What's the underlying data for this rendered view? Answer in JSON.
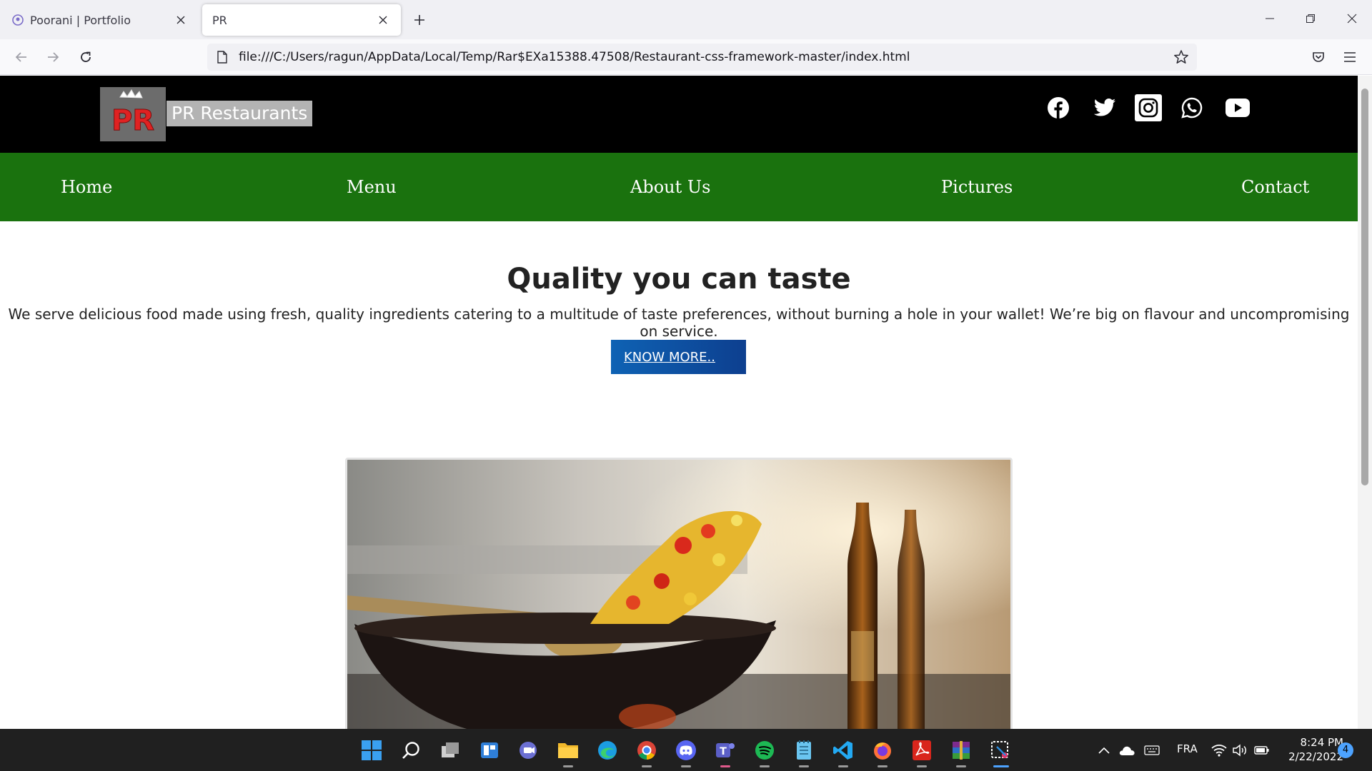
{
  "browser": {
    "tabs": [
      {
        "title": "Poorani | Portfolio",
        "active": false
      },
      {
        "title": "PR",
        "active": true
      }
    ],
    "url": "file:///C:/Users/ragun/AppData/Local/Temp/Rar$EXa15388.47508/Restaurant-css-framework-master/index.html"
  },
  "site": {
    "brand": "PR Restaurants",
    "logo_text": "PR",
    "social": [
      "facebook-icon",
      "twitter-icon",
      "instagram-icon",
      "whatsapp-icon",
      "youtube-icon"
    ],
    "nav": [
      "Home",
      "Menu",
      "About Us",
      "Pictures",
      "Contact"
    ],
    "hero": {
      "title": "Quality you can taste",
      "text": "We serve delicious food made using fresh, quality ingredients catering to a multitude of taste preferences, without burning a hole in your wallet! We’re big on flavour and uncompromising on service.",
      "button": "KNOW MORE.."
    },
    "colors": {
      "header": "#000000",
      "menu": "#1a720e",
      "button": "#0e62b4"
    }
  },
  "taskbar": {
    "language": "FRA",
    "time": "8:24 PM",
    "date": "2/22/2022",
    "notifications": "4"
  }
}
